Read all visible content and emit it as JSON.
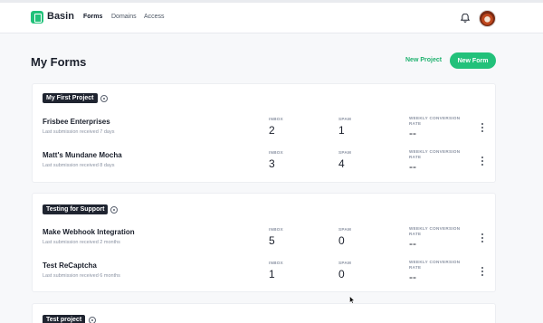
{
  "app": {
    "brand": "Basin"
  },
  "nav": {
    "items": [
      "Forms",
      "Domains",
      "Access"
    ]
  },
  "header": {
    "title": "My Forms",
    "new_project_label": "New Project",
    "new_form_label": "New Form"
  },
  "stat_labels": {
    "inbox": "INBOX",
    "spam": "SPAM",
    "conversion_line1": "WEEKLY CONVERSION",
    "conversion_line2": "RATE"
  },
  "projects": [
    {
      "name": "My First Project",
      "forms": [
        {
          "name": "Frisbee Enterprises",
          "last": "Last submission received 7 days",
          "inbox": "2",
          "spam": "1",
          "conversion": "--"
        },
        {
          "name": "Matt's Mundane Mocha",
          "last": "Last submission received 8 days",
          "inbox": "3",
          "spam": "4",
          "conversion": "--"
        }
      ]
    },
    {
      "name": "Testing for Support",
      "forms": [
        {
          "name": "Make Webhook Integration",
          "last": "Last submission received 2 months",
          "inbox": "5",
          "spam": "0",
          "conversion": "--"
        },
        {
          "name": "Test ReCaptcha",
          "last": "Last submission received 6 months",
          "inbox": "1",
          "spam": "0",
          "conversion": "--"
        }
      ]
    },
    {
      "name": "Test project",
      "forms": []
    }
  ],
  "colors": {
    "accent": "#22c17a",
    "badge": "#1f2430"
  }
}
